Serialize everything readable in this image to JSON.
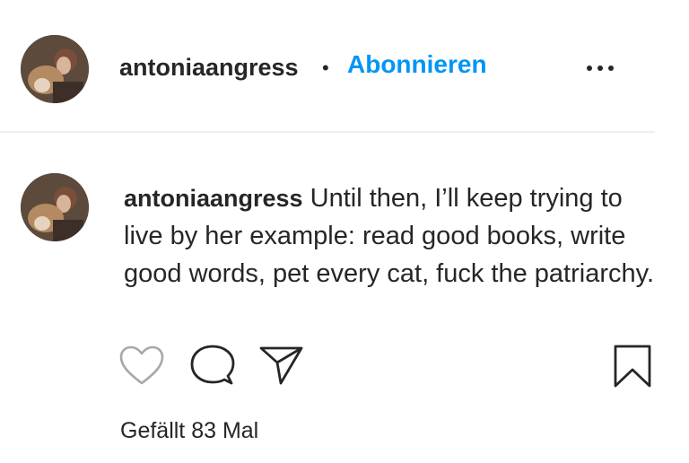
{
  "header": {
    "username": "antoniaangress",
    "separator": "•",
    "follow_label": "Abonnieren",
    "more_icon": "more-horizontal-icon"
  },
  "comment": {
    "username": "antoniaangress",
    "text": "Until then, I’ll keep trying to live by her example: read good books, write good words, pet every cat, fuck the patriarchy."
  },
  "actions": {
    "like_icon": "heart-icon",
    "comment_icon": "comment-bubble-icon",
    "share_icon": "paper-plane-icon",
    "save_icon": "bookmark-icon"
  },
  "likes": {
    "text": "Gefällt 83 Mal"
  },
  "colors": {
    "link": "#0095f6",
    "text": "#262626",
    "divider": "#efefef"
  }
}
